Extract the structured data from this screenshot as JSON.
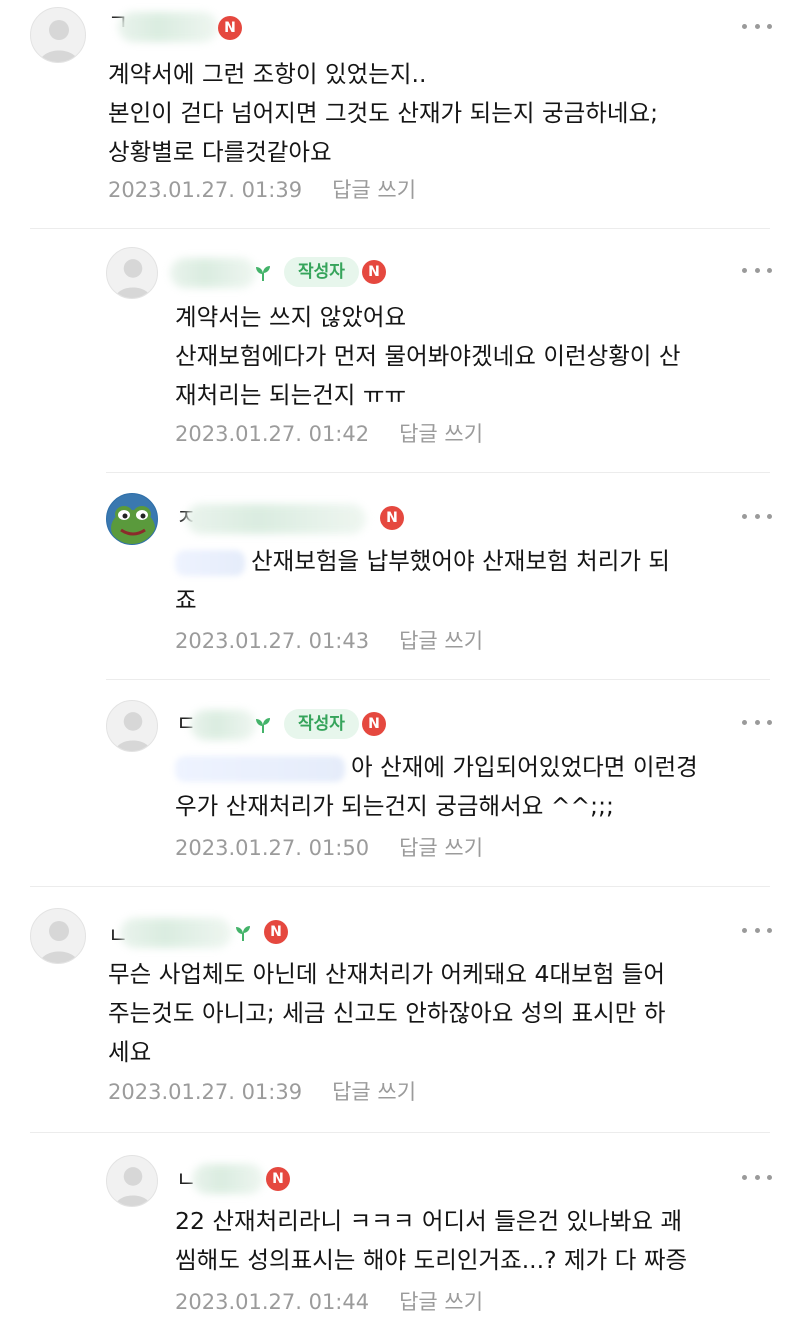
{
  "author_badge_label": "작성자",
  "new_badge_label": "N",
  "reply_label": "답글 쓰기",
  "comments": [
    {
      "lines": [
        "계약서에 그런 조항이 있었는지..",
        "본인이 걷다 넘어지면 그것도 산재가 되는지 궁금하네요;",
        "상황별로 다를것같아요"
      ],
      "time": "2023.01.27. 01:39",
      "nick_prefix": "ㄱ"
    },
    {
      "lines": [
        "계약서는 쓰지 않았어요",
        "산재보험에다가 먼저 물어봐야겠네요 이런상황이 산",
        "재처리는 되는건지 ㅠㅠ"
      ],
      "time": "2023.01.27. 01:42"
    },
    {
      "lines": [
        "산재보험을 납부했어야 산재보험 처리가 되",
        "죠"
      ],
      "time": "2023.01.27. 01:43",
      "nick_prefix": "ㅈ"
    },
    {
      "lines": [
        "아 산재에 가입되어있었다면 이런경",
        "우가 산재처리가 되는건지 궁금해서요 ^^;;;"
      ],
      "time": "2023.01.27. 01:50",
      "nick_prefix": "ㄷ"
    },
    {
      "lines": [
        "무슨 사업체도 아닌데 산재처리가 어케돼요 4대보험 들어",
        "주는것도 아니고; 세금 신고도 안하잖아요 성의 표시만 하",
        "세요"
      ],
      "time": "2023.01.27. 01:39",
      "nick_prefix": "ㄴ"
    },
    {
      "lines": [
        "22 산재처리라니 ㅋㅋㅋ 어디서 들은건 있나봐요 괘",
        "씸해도 성의표시는 해야 도리인거죠...? 제가 다 짜증"
      ],
      "time": "2023.01.27. 01:44",
      "nick_prefix": "ㄴ"
    }
  ]
}
